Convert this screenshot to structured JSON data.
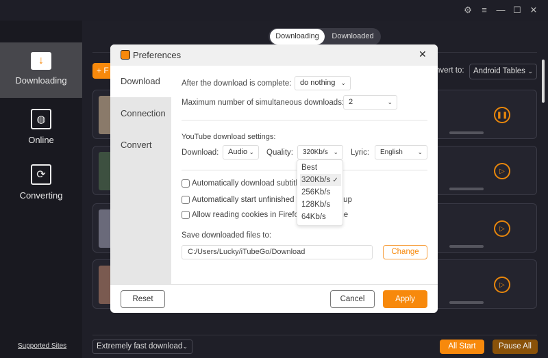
{
  "window": {
    "controls": [
      "settings-icon",
      "menu-icon",
      "minimize-icon",
      "maximize-icon",
      "close-icon"
    ]
  },
  "sidebar": {
    "items": [
      {
        "label": "Downloading",
        "icon": "download-icon",
        "active": true
      },
      {
        "label": "Online",
        "icon": "globe-icon"
      },
      {
        "label": "Converting",
        "icon": "convert-icon"
      }
    ],
    "supported_sites": "Supported Sites"
  },
  "tabs": {
    "downloading": "Downloading",
    "downloaded": "Downloaded"
  },
  "toolbar": {
    "add_label": "F",
    "convert_to_label": "nvert to:",
    "convert_to_value": "Android Tables"
  },
  "cards": [
    {
      "state": "pause"
    },
    {
      "state": "play"
    },
    {
      "state": "play"
    },
    {
      "state": "play"
    }
  ],
  "footer": {
    "speed": "Extremely fast download",
    "all_start": "All Start",
    "pause_all": "Pause All"
  },
  "colors": {
    "accent": "#f7890c",
    "pause_all": "#8a5209"
  },
  "dialog": {
    "title": "Preferences",
    "nav": [
      "Download",
      "Connection",
      "Convert"
    ],
    "after_complete_label": "After the download is complete:",
    "after_complete_value": "do nothing",
    "max_downloads_label": "Maximum number of simultaneous downloads:",
    "max_downloads_value": "2",
    "youtube_settings_label": "YouTube download settings:",
    "download_label": "Download:",
    "download_value": "Audio",
    "quality_label": "Quality:",
    "quality_value": "320Kb/s",
    "lyric_label": "Lyric:",
    "lyric_value": "English",
    "quality_options": [
      "Best",
      "320Kb/s",
      "256Kb/s",
      "128Kb/s",
      "64Kb/s"
    ],
    "checkboxes": [
      "Automatically download subtitles",
      "Automatically start unfinished tasks on startup",
      "Allow reading cookies in Firefox and Chrome"
    ],
    "save_label": "Save downloaded files to:",
    "save_path": "C:/Users/Lucky/iTubeGo/Download",
    "change": "Change",
    "reset": "Reset",
    "cancel": "Cancel",
    "apply": "Apply"
  }
}
